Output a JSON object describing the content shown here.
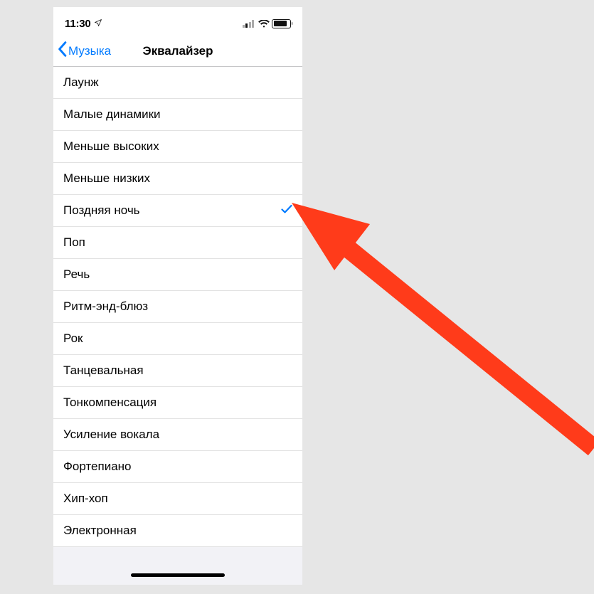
{
  "status_bar": {
    "time": "11:30",
    "battery_percent": 85,
    "icons": [
      "location-arrow",
      "signal",
      "wifi",
      "battery"
    ]
  },
  "nav": {
    "back_label": "Музыка",
    "title": "Эквалайзер"
  },
  "list": {
    "items": [
      {
        "label": "Лаунж",
        "selected": false
      },
      {
        "label": "Малые динамики",
        "selected": false
      },
      {
        "label": "Меньше высоких",
        "selected": false
      },
      {
        "label": "Меньше низких",
        "selected": false
      },
      {
        "label": "Поздняя ночь",
        "selected": true
      },
      {
        "label": "Поп",
        "selected": false
      },
      {
        "label": "Речь",
        "selected": false
      },
      {
        "label": "Ритм-энд-блюз",
        "selected": false
      },
      {
        "label": "Рок",
        "selected": false
      },
      {
        "label": "Танцевальная",
        "selected": false
      },
      {
        "label": "Тонкомпенсация",
        "selected": false
      },
      {
        "label": "Усиление вокала",
        "selected": false
      },
      {
        "label": "Фортепиано",
        "selected": false
      },
      {
        "label": "Хип-хоп",
        "selected": false
      },
      {
        "label": "Электронная",
        "selected": false
      }
    ]
  },
  "annotation": {
    "arrow_color": "#ff3b1a",
    "points_to": "Поздняя ночь checkmark"
  }
}
